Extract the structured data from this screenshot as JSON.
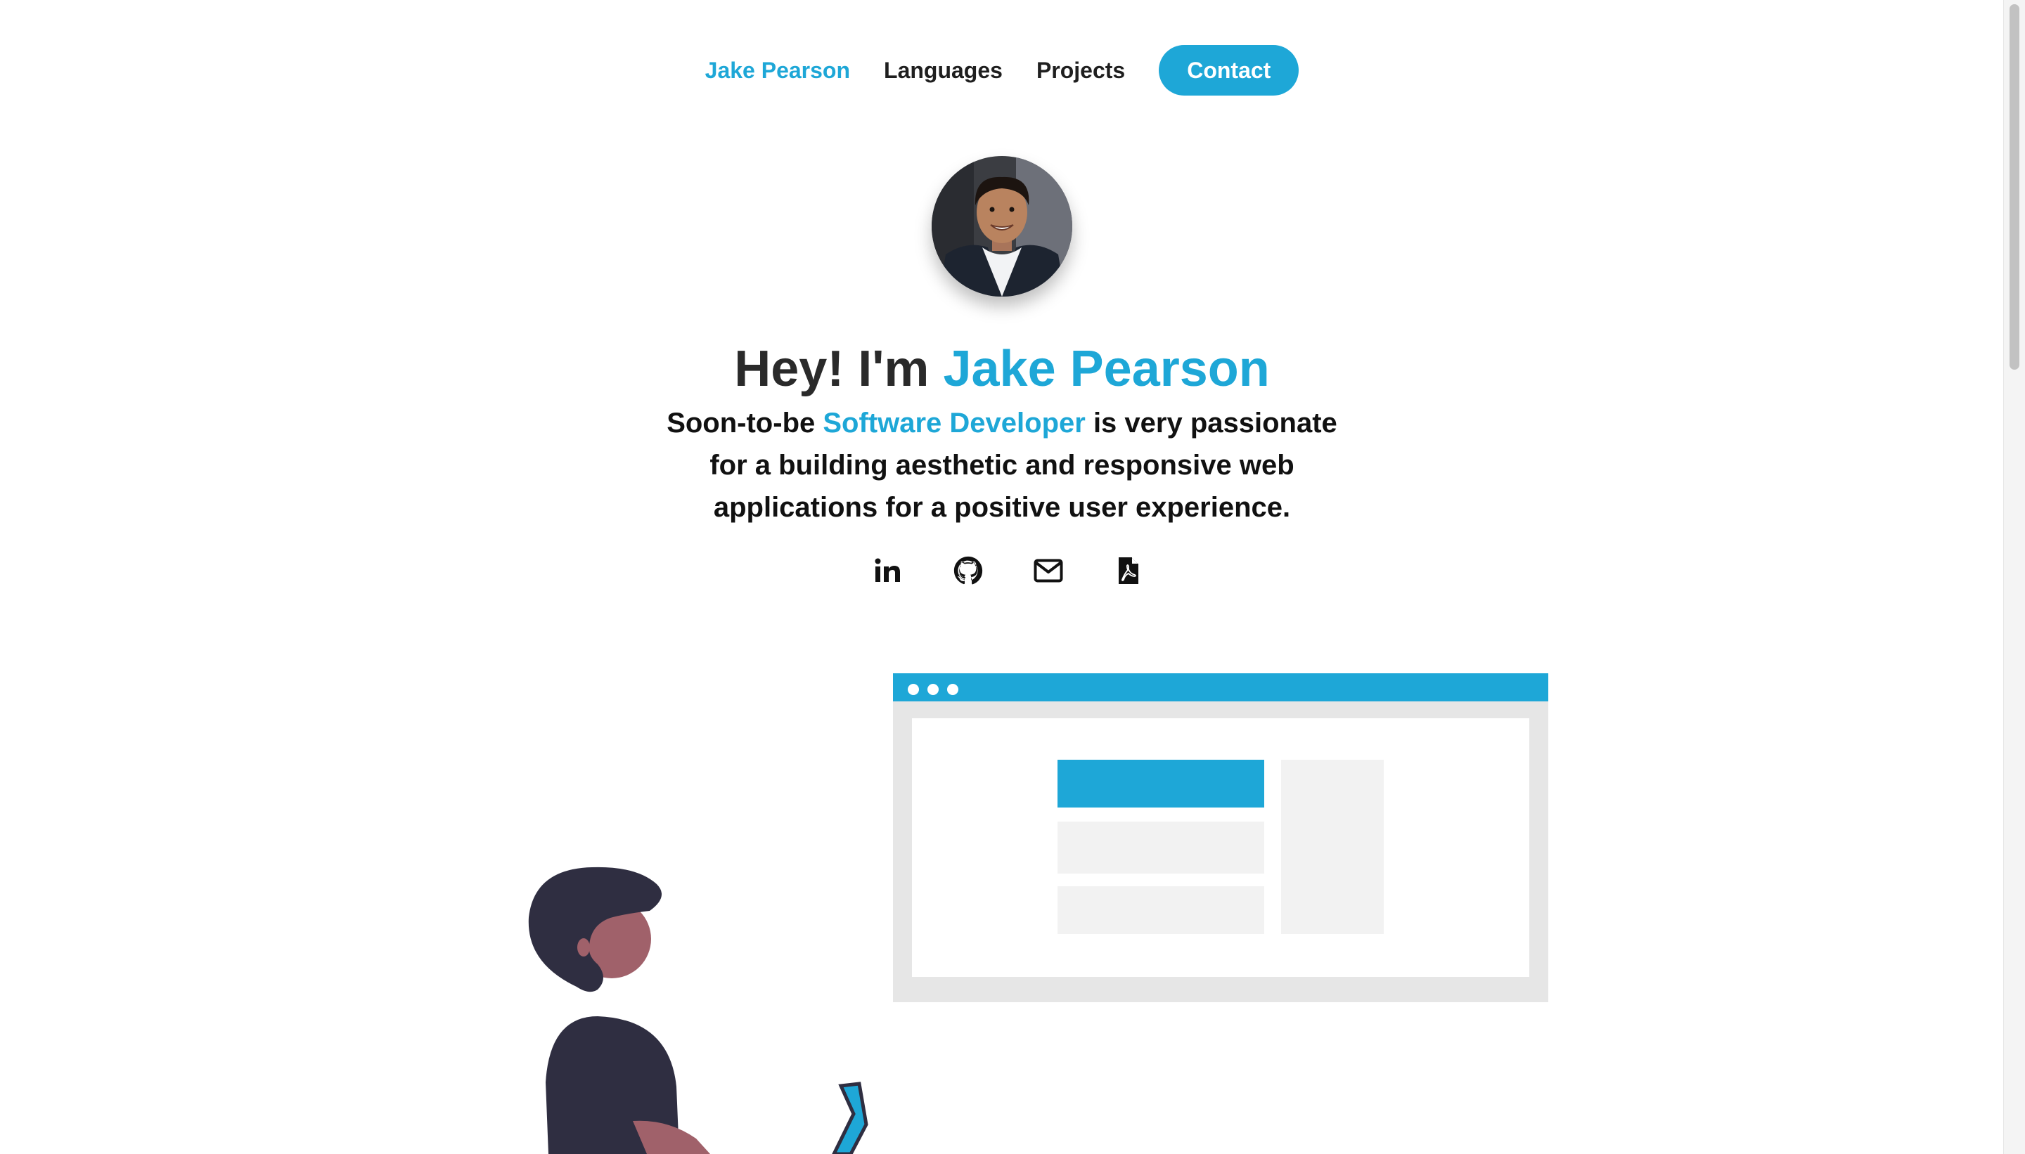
{
  "nav": {
    "brand": "Jake Pearson",
    "languages": "Languages",
    "projects": "Projects",
    "contact": "Contact"
  },
  "hero": {
    "greeting": "Hey! I'm ",
    "name": "Jake Pearson",
    "sub_prefix": "Soon-to-be ",
    "sub_role": "Software Developer",
    "sub_rest": " is very passionate for a building aesthetic and responsive web applications for a positive user experience."
  },
  "social": {
    "icons": [
      "linkedin-icon",
      "github-icon",
      "email-icon",
      "pdf-resume-icon"
    ]
  },
  "colors": {
    "accent": "#1ea7d7",
    "text": "#1f1f1f",
    "figure_dark": "#2f2e41",
    "figure_skin": "#a0616a"
  }
}
